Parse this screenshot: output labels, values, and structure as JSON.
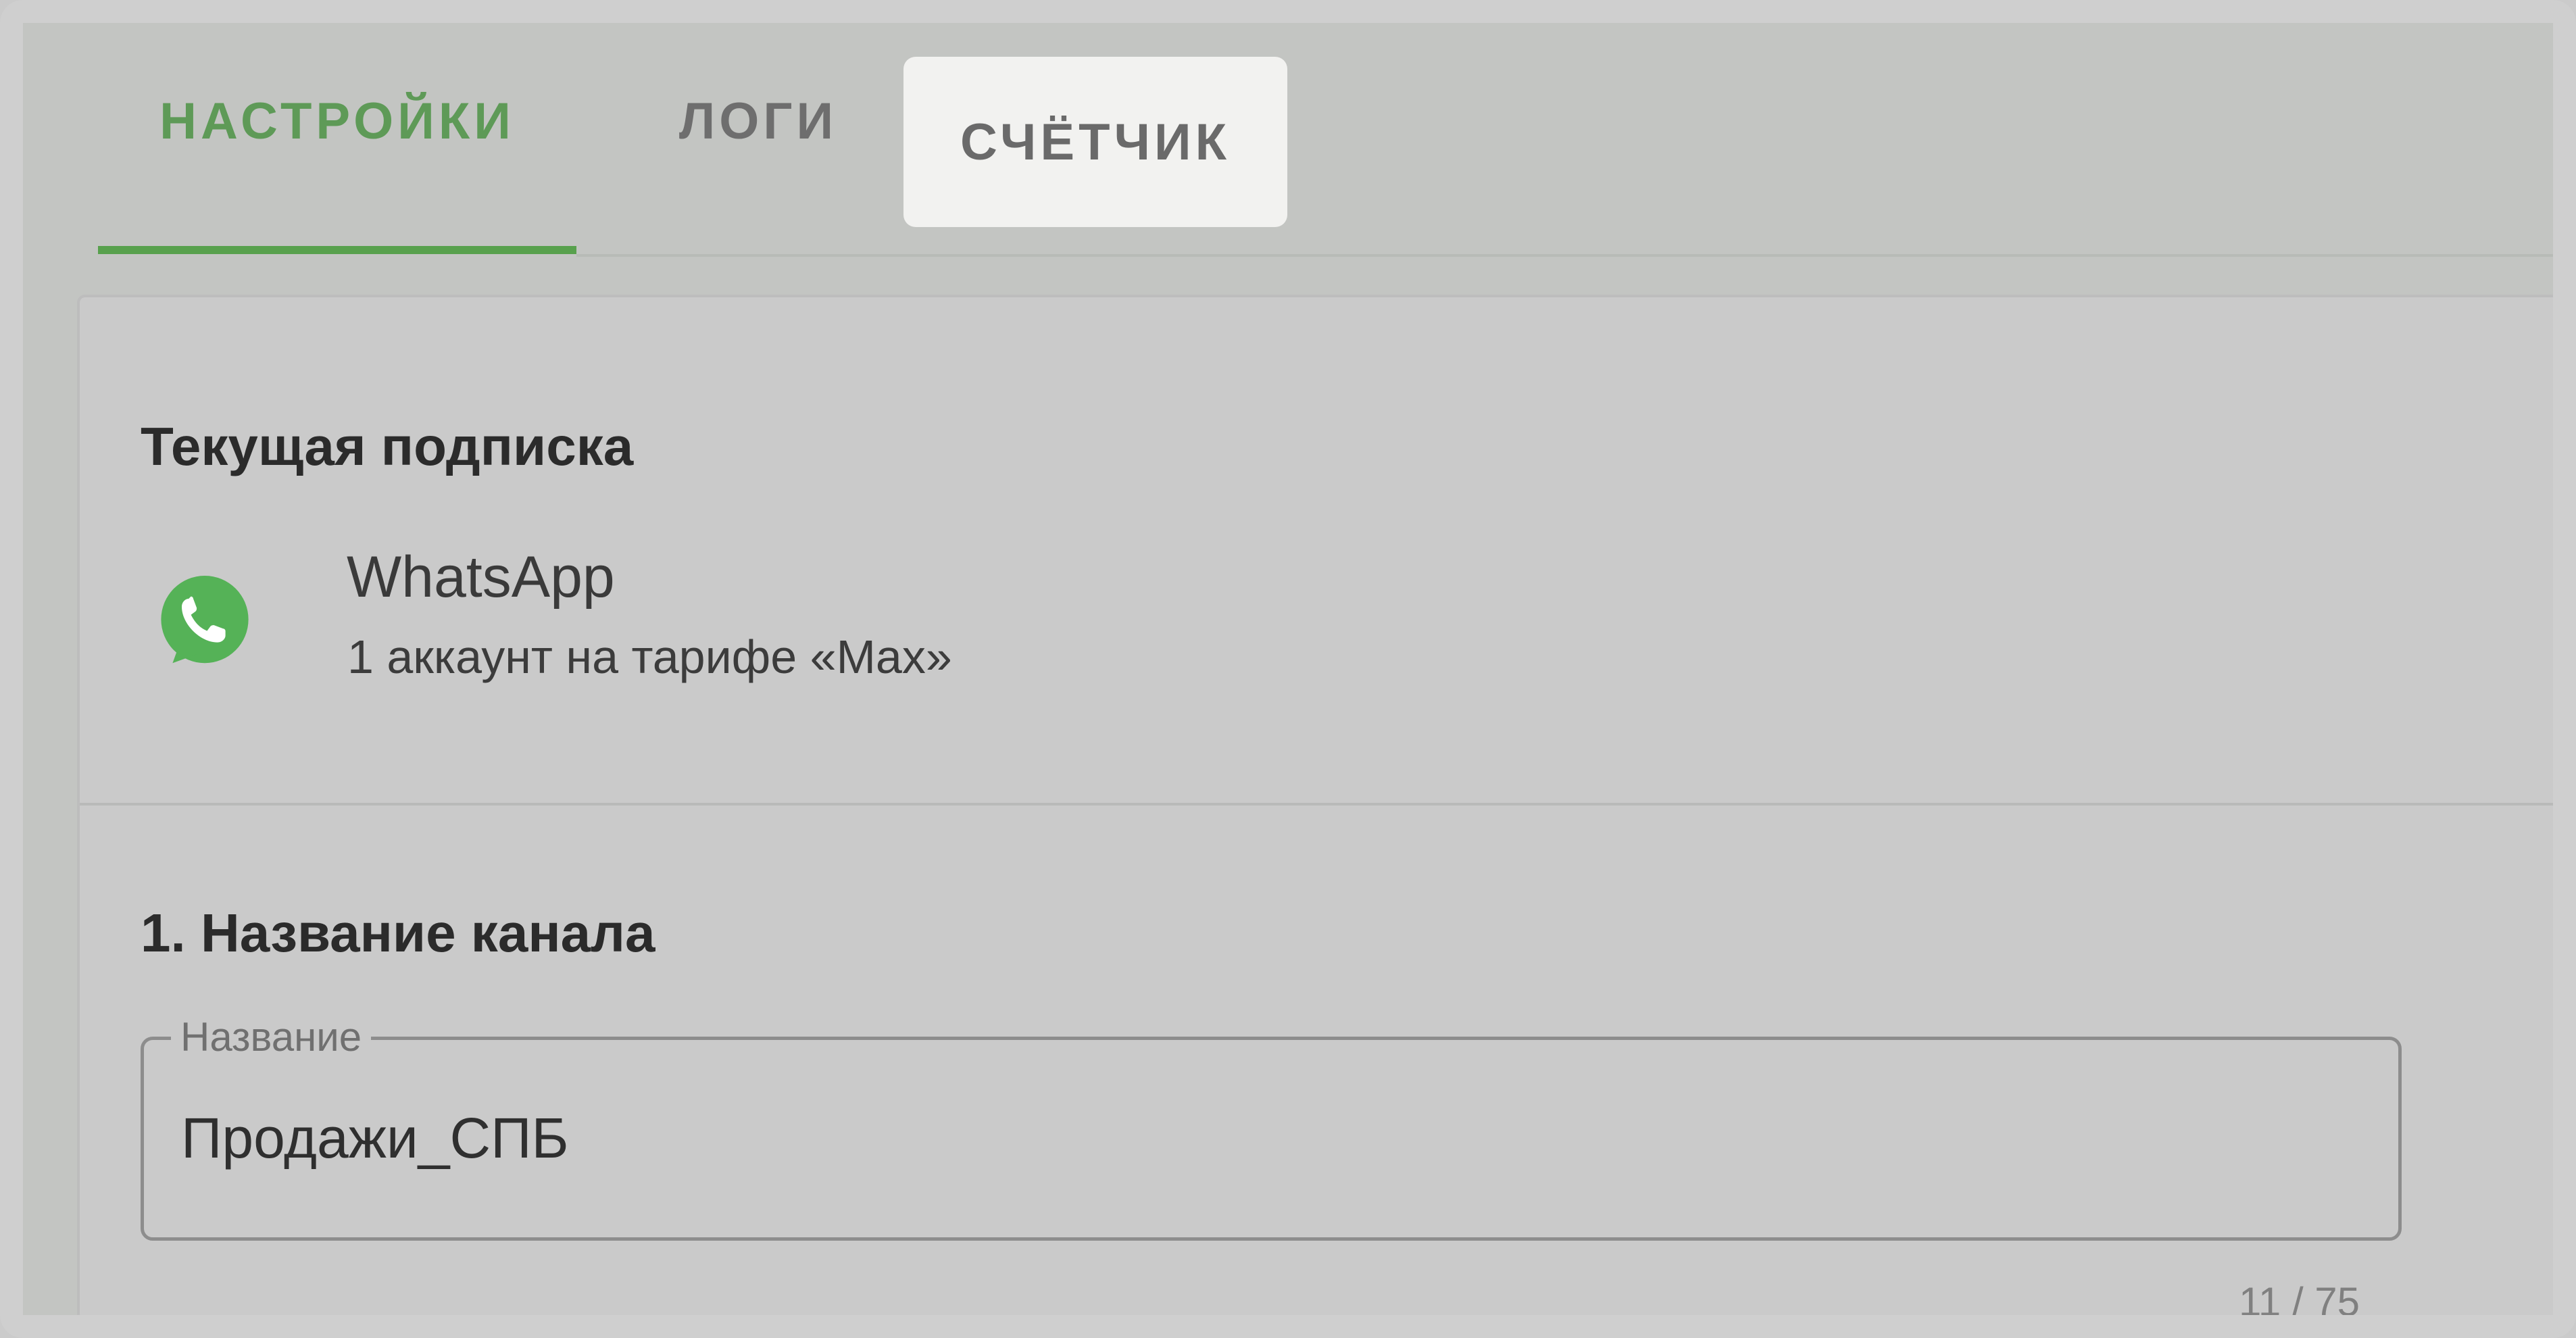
{
  "tabs": [
    {
      "label": "НАСТРОЙКИ",
      "active": true
    },
    {
      "label": "ЛОГИ",
      "active": false
    },
    {
      "label": "СЧЁТЧИК",
      "active": false,
      "highlighted": true
    }
  ],
  "subscription": {
    "title": "Текущая подписка",
    "service_name": "WhatsApp",
    "detail": "1 аккаунт на тарифе «Max»",
    "icon": "whatsapp-icon",
    "icon_color": "#55b257"
  },
  "channel": {
    "title": "1. Название канала",
    "field_label": "Название",
    "value": "Продажи_СПБ",
    "counter": "11 / 75"
  },
  "colors": {
    "accent": "#58a14d",
    "active_tab_text": "#5e9a57",
    "background": "#c3c5c2"
  }
}
